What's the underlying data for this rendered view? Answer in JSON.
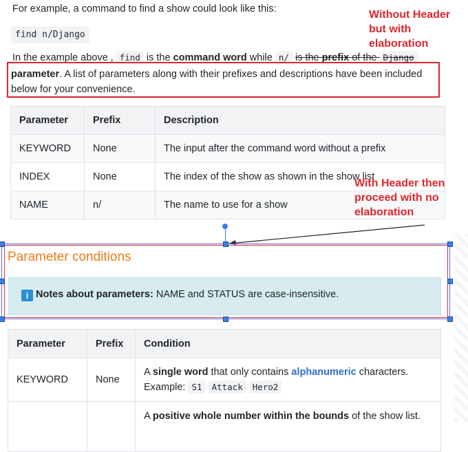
{
  "intro": "For example, a command to find a show could look like this:",
  "command": "find n/Django",
  "line3": {
    "t1": "In the example above ,",
    "code1": "find",
    "t2": "is the",
    "bold1": "command word",
    "t3": "while",
    "code2": "n/",
    "t4": "is the",
    "bold2": "prefix",
    "t5": "of the",
    "code3": "Django"
  },
  "paragraph": {
    "bold": "parameter",
    "rest": ". A list of parameters along with their prefixes and descriptions have been included below for your convenience."
  },
  "annotations": {
    "top": "Without Header but with elaboration",
    "middle": "With Header then proceed with no elaboration"
  },
  "table1": {
    "headers": [
      "Parameter",
      "Prefix",
      "Description"
    ],
    "rows": [
      [
        "KEYWORD",
        "None",
        "The input after the command word without a prefix"
      ],
      [
        "INDEX",
        "None",
        "The index of the show as shown in the show list"
      ],
      [
        "NAME",
        "n/",
        "The name to use for a show"
      ]
    ]
  },
  "section": {
    "heading": "Parameter conditions",
    "note_icon": "info-icon",
    "note_bold": "Notes about parameters:",
    "note_text": " NAME and STATUS are case-insensitive."
  },
  "table2": {
    "headers": [
      "Parameter",
      "Prefix",
      "Condition"
    ],
    "row1": {
      "param": "KEYWORD",
      "prefix": "None",
      "c1": "A ",
      "c_bold": "single word",
      "c2": " that only contains ",
      "c_blue": "alphanumeric",
      "c3": " characters.",
      "example_label": "Example:",
      "examples": [
        "S1",
        "Attack",
        "Hero2"
      ]
    },
    "row2": {
      "c1": "A ",
      "c_bold": "positive whole number within the bounds",
      "c2": " of the show list."
    }
  },
  "colors": {
    "annotation": "#e0262c",
    "heading": "#ee7b18",
    "link": "#2f6fcf",
    "callout": "#d7ecf1"
  }
}
